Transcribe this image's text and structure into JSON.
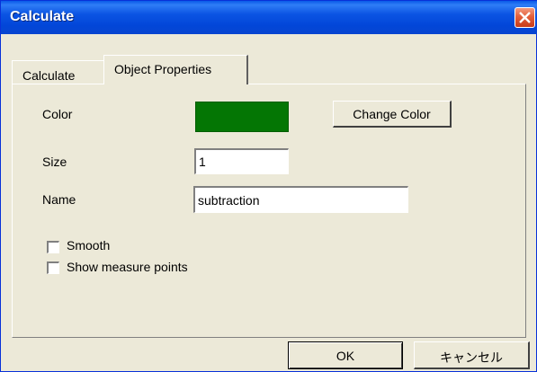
{
  "window": {
    "title": "Calculate"
  },
  "tabs": [
    {
      "label": "Calculate",
      "selected": false
    },
    {
      "label": "Object Properties",
      "selected": true
    }
  ],
  "properties": {
    "color_label": "Color",
    "color_value": "#047604",
    "change_color_label": "Change Color",
    "size_label": "Size",
    "size_value": "1",
    "name_label": "Name",
    "name_value": "subtraction"
  },
  "options": {
    "smooth_label": "Smooth",
    "smooth_checked": false,
    "measure_label": "Show measure points",
    "measure_checked": false
  },
  "footer": {
    "ok_label": "OK",
    "cancel_label": "キャンセル"
  },
  "icons": {
    "close": "close-icon"
  }
}
